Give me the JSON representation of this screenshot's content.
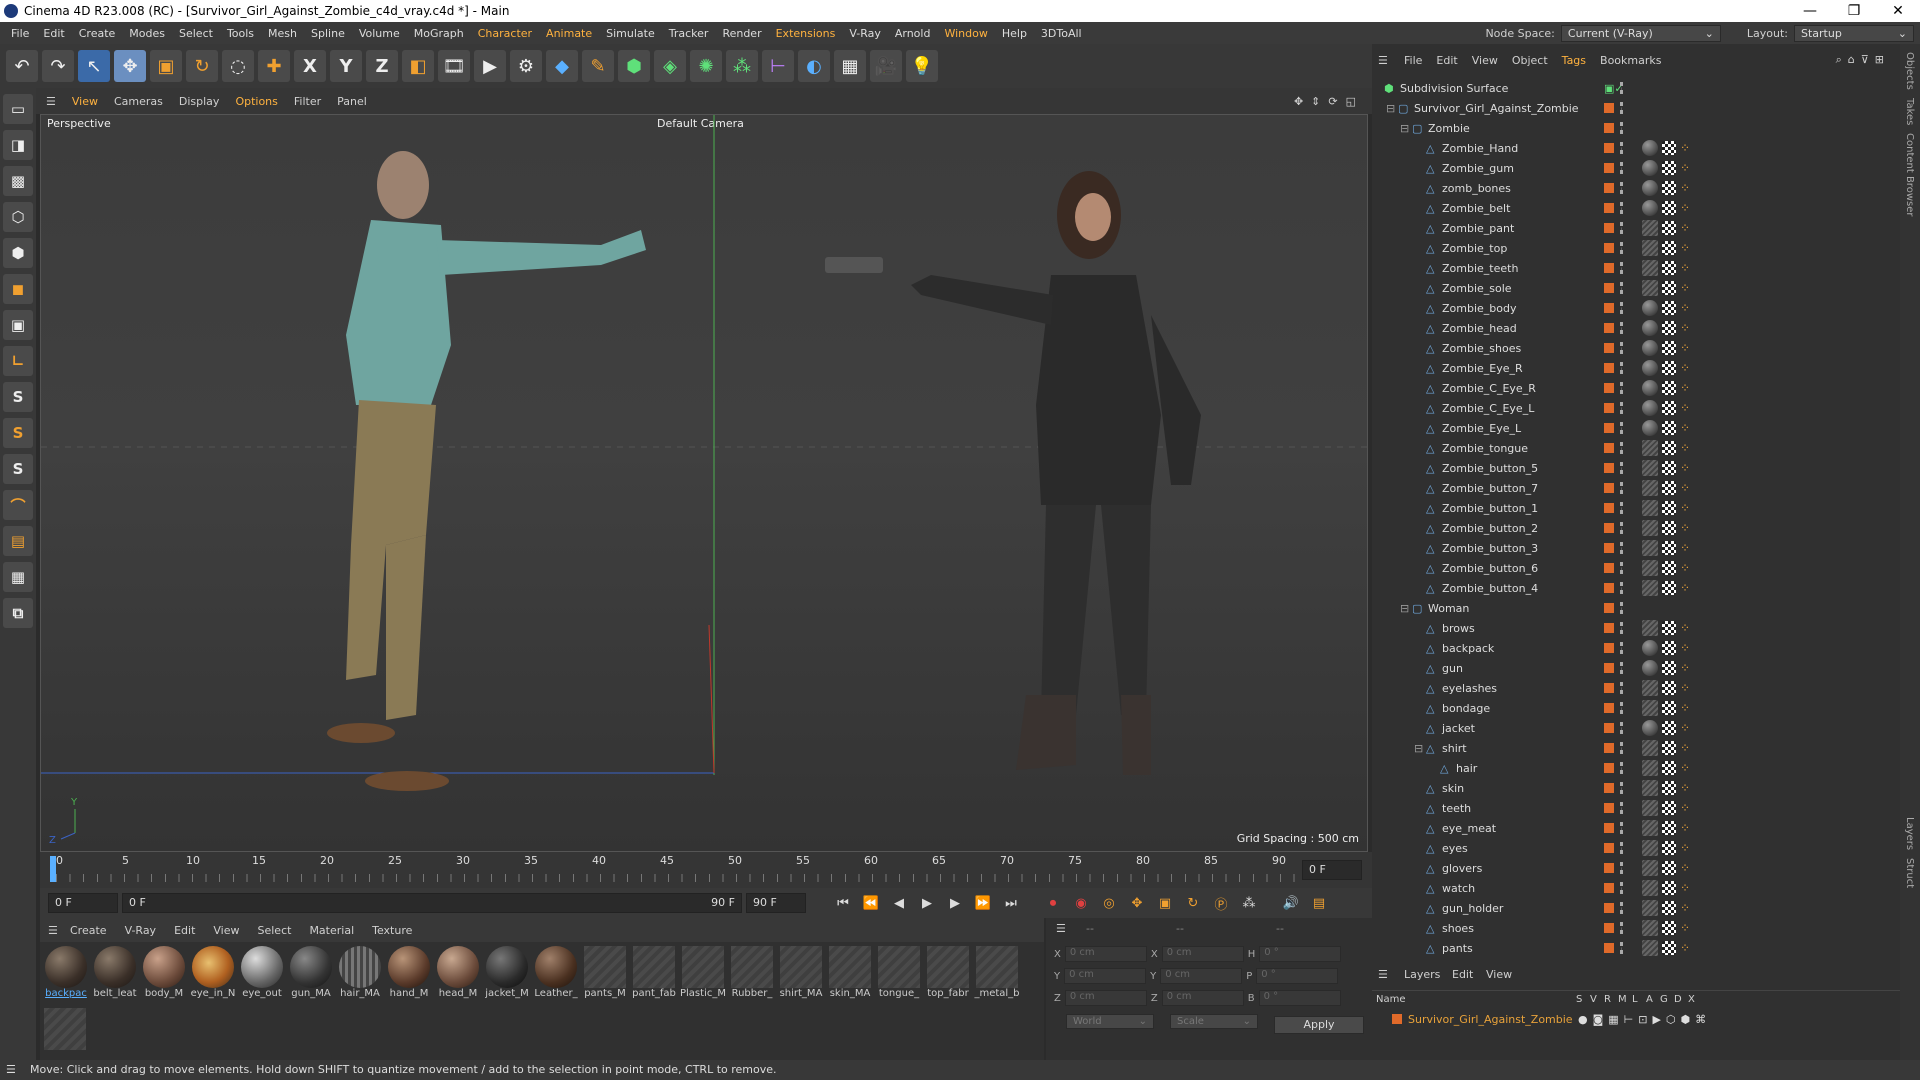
{
  "window": {
    "title": "Cinema 4D R23.008 (RC) - [Survivor_Girl_Against_Zombie_c4d_vray.c4d *] - Main",
    "controls": [
      "—",
      "❐",
      "✕"
    ]
  },
  "menubar": {
    "items": [
      "File",
      "Edit",
      "Create",
      "Modes",
      "Select",
      "Tools",
      "Mesh",
      "Spline",
      "Volume",
      "MoGraph",
      "Character",
      "Animate",
      "Simulate",
      "Tracker",
      "Render",
      "Extensions",
      "V-Ray",
      "Arnold",
      "Window",
      "Help",
      "3DToAll"
    ],
    "node_space_label": "Node Space:",
    "node_space_value": "Current (V-Ray)",
    "layout_label": "Layout:",
    "layout_value": "Startup"
  },
  "toolbar": {
    "icons": [
      "undo-icon",
      "redo-icon",
      "select-icon",
      "move-icon",
      "scale-icon",
      "rotate-icon",
      "live-select-icon",
      "add-icon",
      "x-axis-icon",
      "y-axis-icon",
      "z-axis-icon",
      "coord-icon",
      "render-region-icon",
      "render-view-icon",
      "render-settings-icon",
      "cube-icon",
      "pen-icon",
      "subdivision-icon",
      "extrude-icon",
      "cloner-icon",
      "mograph-icon",
      "deformer-icon",
      "spline-icon",
      "floor-icon",
      "camera-icon",
      "light-icon"
    ],
    "axis_labels": [
      "X",
      "Y",
      "Z"
    ]
  },
  "viewport": {
    "menu": [
      "View",
      "Cameras",
      "Display",
      "Options",
      "Filter",
      "Panel"
    ],
    "label": "Perspective",
    "camera": "Default Camera",
    "grid_spacing": "Grid Spacing : 500 cm"
  },
  "timeline": {
    "ticks": [
      "0",
      "5",
      "10",
      "15",
      "20",
      "25",
      "30",
      "35",
      "40",
      "45",
      "50",
      "55",
      "60",
      "65",
      "70",
      "75",
      "80",
      "85",
      "90"
    ],
    "current": "0 F",
    "start": "0 F",
    "start2": "0 F",
    "end": "90 F",
    "end2": "90 F",
    "right_field": "0 F"
  },
  "materials": {
    "menu": [
      "Create",
      "V-Ray",
      "Edit",
      "View",
      "Select",
      "Material",
      "Texture"
    ],
    "items": [
      {
        "name": "backpac",
        "kind": "ball",
        "selected": true
      },
      {
        "name": "belt_leat",
        "kind": "ball"
      },
      {
        "name": "body_M",
        "kind": "ball"
      },
      {
        "name": "eye_in_N",
        "kind": "ball"
      },
      {
        "name": "eye_out",
        "kind": "ball"
      },
      {
        "name": "gun_MA",
        "kind": "ball"
      },
      {
        "name": "hair_MA",
        "kind": "ball"
      },
      {
        "name": "hand_M",
        "kind": "ball"
      },
      {
        "name": "head_M",
        "kind": "ball"
      },
      {
        "name": "jacket_M",
        "kind": "ball"
      },
      {
        "name": "Leather_",
        "kind": "ball"
      },
      {
        "name": "pants_M",
        "kind": "flat"
      },
      {
        "name": "pant_fab",
        "kind": "flat"
      },
      {
        "name": "Plastic_M",
        "kind": "flat"
      },
      {
        "name": "Rubber_",
        "kind": "flat"
      },
      {
        "name": "shirt_MA",
        "kind": "flat"
      },
      {
        "name": "skin_MA",
        "kind": "flat"
      },
      {
        "name": "tongue_",
        "kind": "flat"
      },
      {
        "name": "top_fabr",
        "kind": "flat"
      },
      {
        "name": "_metal_b",
        "kind": "flat"
      }
    ]
  },
  "attributes": {
    "header": "--",
    "rows": [
      {
        "l1": "X",
        "v1": "0 cm",
        "l2": "X",
        "v2": "0 cm",
        "l3": "H",
        "v3": "0 °"
      },
      {
        "l1": "Y",
        "v1": "0 cm",
        "l2": "Y",
        "v2": "0 cm",
        "l3": "P",
        "v3": "0 °"
      },
      {
        "l1": "Z",
        "v1": "0 cm",
        "l2": "Z",
        "v2": "0 cm",
        "l3": "B",
        "v3": "0 °"
      }
    ],
    "coord_mode": "World",
    "size_mode": "Scale",
    "apply": "Apply"
  },
  "status": "Move: Click and drag to move elements. Hold down SHIFT to quantize movement / add to the selection in point mode, CTRL to remove.",
  "objects": {
    "menu": [
      "File",
      "Edit",
      "View",
      "Object",
      "Tags",
      "Bookmarks"
    ],
    "rows": [
      {
        "name": "Subdivision Surface",
        "indent": 0,
        "tag": "none"
      },
      {
        "name": "Survivor_Girl_Against_Zombie",
        "indent": 1,
        "tag": "none"
      },
      {
        "name": "Zombie",
        "indent": 2,
        "tag": "none"
      },
      {
        "name": "Zombie_Hand",
        "indent": 3,
        "tag": "ball"
      },
      {
        "name": "Zombie_gum",
        "indent": 3,
        "tag": "ball"
      },
      {
        "name": "zomb_bones",
        "indent": 3,
        "tag": "ball"
      },
      {
        "name": "Zombie_belt",
        "indent": 3,
        "tag": "ball"
      },
      {
        "name": "Zombie_pant",
        "indent": 3,
        "tag": "flat"
      },
      {
        "name": "Zombie_top",
        "indent": 3,
        "tag": "flat"
      },
      {
        "name": "Zombie_teeth",
        "indent": 3,
        "tag": "flat"
      },
      {
        "name": "Zombie_sole",
        "indent": 3,
        "tag": "flat"
      },
      {
        "name": "Zombie_body",
        "indent": 3,
        "tag": "ball"
      },
      {
        "name": "Zombie_head",
        "indent": 3,
        "tag": "ball"
      },
      {
        "name": "Zombie_shoes",
        "indent": 3,
        "tag": "ball"
      },
      {
        "name": "Zombie_Eye_R",
        "indent": 3,
        "tag": "ball"
      },
      {
        "name": "Zombie_C_Eye_R",
        "indent": 3,
        "tag": "ball"
      },
      {
        "name": "Zombie_C_Eye_L",
        "indent": 3,
        "tag": "ball"
      },
      {
        "name": "Zombie_Eye_L",
        "indent": 3,
        "tag": "ball"
      },
      {
        "name": "Zombie_tongue",
        "indent": 3,
        "tag": "flat"
      },
      {
        "name": "Zombie_button_5",
        "indent": 3,
        "tag": "flat"
      },
      {
        "name": "Zombie_button_7",
        "indent": 3,
        "tag": "flat"
      },
      {
        "name": "Zombie_button_1",
        "indent": 3,
        "tag": "flat"
      },
      {
        "name": "Zombie_button_2",
        "indent": 3,
        "tag": "flat"
      },
      {
        "name": "Zombie_button_3",
        "indent": 3,
        "tag": "flat"
      },
      {
        "name": "Zombie_button_6",
        "indent": 3,
        "tag": "flat"
      },
      {
        "name": "Zombie_button_4",
        "indent": 3,
        "tag": "flat"
      },
      {
        "name": "Woman",
        "indent": 2,
        "tag": "none"
      },
      {
        "name": "brows",
        "indent": 3,
        "tag": "flat"
      },
      {
        "name": "backpack",
        "indent": 3,
        "tag": "ball"
      },
      {
        "name": "gun",
        "indent": 3,
        "tag": "ball"
      },
      {
        "name": "eyelashes",
        "indent": 3,
        "tag": "flat"
      },
      {
        "name": "bondage",
        "indent": 3,
        "tag": "flat"
      },
      {
        "name": "jacket",
        "indent": 3,
        "tag": "ball"
      },
      {
        "name": "shirt",
        "indent": 3,
        "tag": "flat"
      },
      {
        "name": "hair",
        "indent": 4,
        "tag": "flat"
      },
      {
        "name": "skin",
        "indent": 3,
        "tag": "flat"
      },
      {
        "name": "teeth",
        "indent": 3,
        "tag": "flat"
      },
      {
        "name": "eye_meat",
        "indent": 3,
        "tag": "flat"
      },
      {
        "name": "eyes",
        "indent": 3,
        "tag": "flat"
      },
      {
        "name": "glovers",
        "indent": 3,
        "tag": "flat"
      },
      {
        "name": "watch",
        "indent": 3,
        "tag": "flat"
      },
      {
        "name": "gun_holder",
        "indent": 3,
        "tag": "flat"
      },
      {
        "name": "shoes",
        "indent": 3,
        "tag": "flat"
      },
      {
        "name": "pants",
        "indent": 3,
        "tag": "flat"
      }
    ]
  },
  "layers": {
    "menu": [
      "Layers",
      "Edit",
      "View"
    ],
    "columns": [
      "Name",
      "S",
      "V",
      "R",
      "M",
      "L",
      "A",
      "G",
      "D",
      "X"
    ],
    "rows": [
      {
        "name": "Survivor_Girl_Against_Zombie",
        "color": "#e06a2a"
      }
    ]
  },
  "side_tabs": [
    "Objects",
    "Takes",
    "Content Browser",
    "Layers",
    "Struct"
  ]
}
